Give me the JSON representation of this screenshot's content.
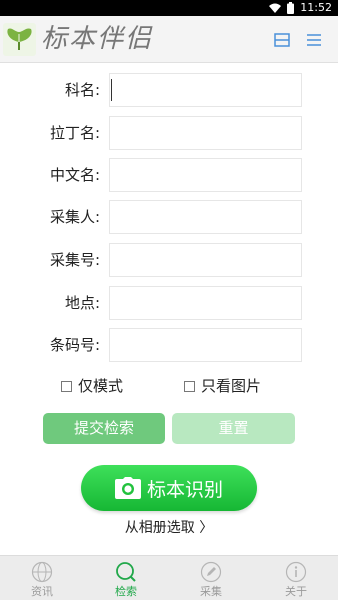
{
  "status_bar": {
    "time": "11:52"
  },
  "app": {
    "title": "标本伴侣"
  },
  "form": {
    "fields": [
      {
        "label": "科名:",
        "value": ""
      },
      {
        "label": "拉丁名:",
        "value": ""
      },
      {
        "label": "中文名:",
        "value": ""
      },
      {
        "label": "采集人:",
        "value": ""
      },
      {
        "label": "采集号:",
        "value": ""
      },
      {
        "label": "地点:",
        "value": ""
      },
      {
        "label": "条码号:",
        "value": ""
      }
    ],
    "checkboxes": {
      "only_mode": {
        "label": "仅模式",
        "checked": false
      },
      "only_images": {
        "label": "只看图片",
        "checked": false
      }
    },
    "submit_label": "提交检索",
    "reset_label": "重置"
  },
  "recognition": {
    "button_label": "标本识别",
    "album_link": "从相册选取 〉"
  },
  "tabs": [
    {
      "label": "资讯",
      "icon": "globe-icon",
      "active": false
    },
    {
      "label": "检索",
      "icon": "search-icon",
      "active": true
    },
    {
      "label": "采集",
      "icon": "pencil-icon",
      "active": false
    },
    {
      "label": "关于",
      "icon": "info-icon",
      "active": false
    }
  ],
  "colors": {
    "accent": "#21a84a",
    "submit": "#6fc97d",
    "reset": "#b8e8c0",
    "tab_inactive": "#9b9b9b",
    "icon_blue": "#4a90d9"
  }
}
